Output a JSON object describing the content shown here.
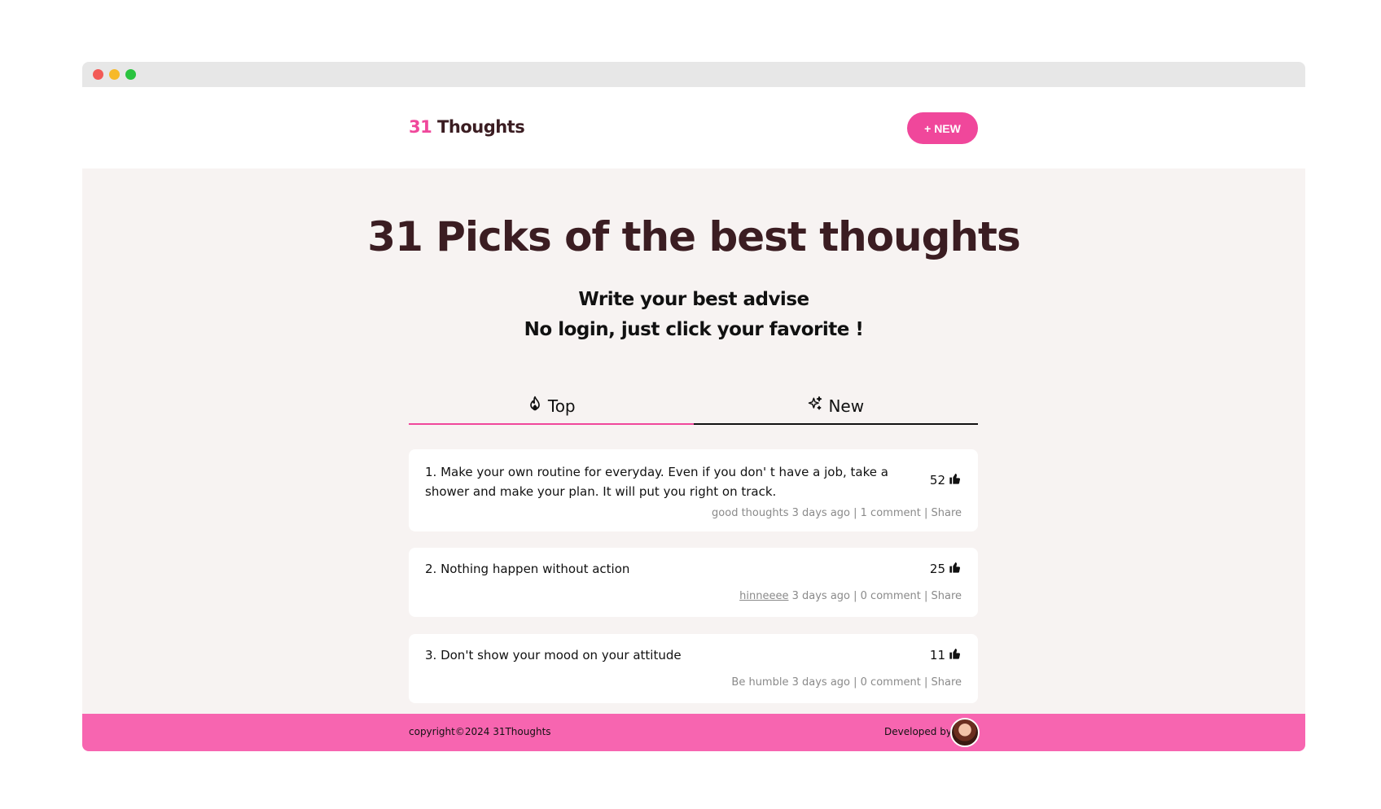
{
  "window": {
    "controls": [
      "close",
      "minimize",
      "maximize"
    ]
  },
  "header": {
    "logo_num": "31",
    "logo_text": " Thoughts",
    "new_button_label": "+ NEW"
  },
  "hero": {
    "title": "31 Picks of the best thoughts",
    "tagline_line1": "Write your best advise",
    "tagline_line2": "No login, just click your favorite !"
  },
  "tabs": [
    {
      "label": "Top",
      "icon": "flame-icon",
      "active": true
    },
    {
      "label": "New",
      "icon": "sparkles-icon",
      "active": false
    }
  ],
  "thoughts": [
    {
      "text": "1. Make your own routine for everyday. Even if you don' t have a job, take a shower and make your plan. It will put you right on track.",
      "votes": "52",
      "author": "good thoughts",
      "time": "3 days ago |",
      "comments": "1 comment |",
      "share": "Share"
    },
    {
      "text": "2. Nothing happen without action",
      "votes": "25",
      "author": "hinneeee",
      "time": "3 days ago |",
      "comments": "0 comment |",
      "share": "Share"
    },
    {
      "text": "3. Don't show your mood on your attitude",
      "votes": "11",
      "author": "Be humble",
      "time": "3 days ago |",
      "comments": "0 comment |",
      "share": "Share"
    }
  ],
  "footer": {
    "copyright": "copyright©2024 31Thoughts",
    "developed_by": "Developed by"
  },
  "colors": {
    "accent": "#f0479b",
    "footer": "#f765b0",
    "heading": "#3b1d22",
    "background": "#f7f3f2"
  }
}
